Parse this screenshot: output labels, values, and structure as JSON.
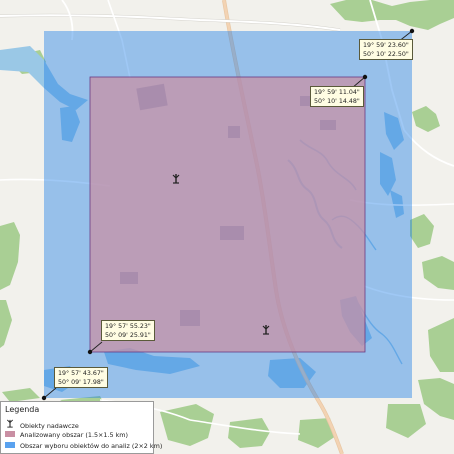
{
  "map": {
    "colors": {
      "background": "#f2f1ec",
      "forest": "#a9cf94",
      "water": "#9ac8e6",
      "road_main": "#f3d3b3",
      "road_minor": "#ffffff",
      "outer_area": "#1a7be8",
      "inner_area": "#c98fa3",
      "inner_border": "#6a3a82"
    },
    "corner_labels": [
      {
        "id": "outer-ne",
        "lon": "19° 59' 23.60\"",
        "lat": "50° 10' 22.50\""
      },
      {
        "id": "inner-ne",
        "lon": "19° 59' 11.04\"",
        "lat": "50° 10' 14.48\""
      },
      {
        "id": "inner-sw",
        "lon": "19° 57' 55.23\"",
        "lat": "50° 09' 25.91\""
      },
      {
        "id": "outer-sw",
        "lon": "19° 57' 43.67\"",
        "lat": "50° 09' 17.98\""
      }
    ],
    "transmitters": [
      {
        "name": "transmitter-north",
        "icon": "antenna-icon"
      },
      {
        "name": "transmitter-south",
        "icon": "antenna-icon"
      }
    ]
  },
  "legend": {
    "title": "Legenda",
    "items": [
      {
        "label": "Obiekty nadawcze",
        "icon": "antenna-icon"
      },
      {
        "label": "Analizowany obszar (1.5×1.5 km)",
        "color": "#c98fa3"
      },
      {
        "label": "Obszar wyboru obiektów do analiz (2×2 km)",
        "color": "#1a7be8"
      }
    ]
  }
}
